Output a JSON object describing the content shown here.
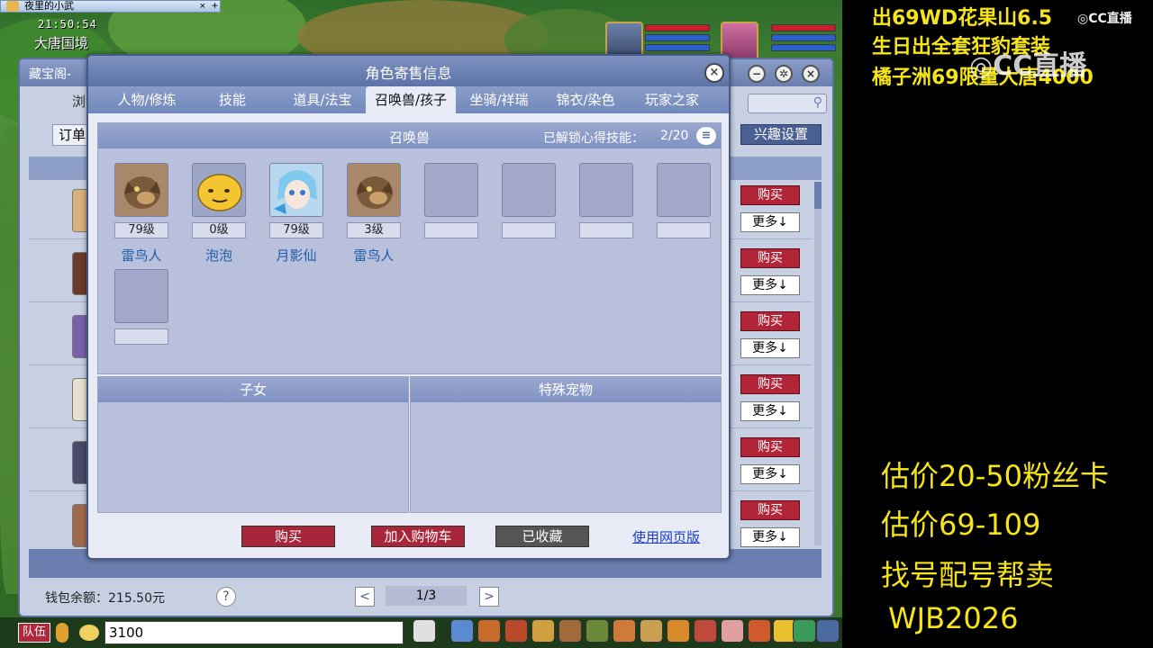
{
  "window": {
    "title": "夜里的小武",
    "close_glyph": "×",
    "plus_glyph": "+"
  },
  "hud": {
    "clock": "21:50:54",
    "location": "大唐国境"
  },
  "background_window": {
    "title": "藏宝阁-",
    "tab_partial": "浏",
    "order_partial": "订单",
    "interest_button": "兴趣设置",
    "buy_label": "购买",
    "more_label": "更多↓",
    "wallet": "钱包余额：215.50元",
    "help": "?",
    "prev": "<",
    "next": ">",
    "page": "1/3",
    "search_icon": "⚲"
  },
  "dialog": {
    "title": "角色寄售信息",
    "close": "×",
    "tabs": [
      {
        "label": "人物/修炼"
      },
      {
        "label": "技能"
      },
      {
        "label": "道具/法宝"
      },
      {
        "label": "召唤兽/孩子"
      },
      {
        "label": "坐骑/祥瑞"
      },
      {
        "label": "锦衣/染色"
      },
      {
        "label": "玩家之家"
      }
    ],
    "active_tab": "召唤兽/孩子",
    "pets_section": {
      "title": "召唤兽",
      "skill_label": "已解锁心得技能：",
      "skill_value": "2/20",
      "list_icon": "≡",
      "pets": [
        {
          "level": "79级",
          "name": "雷鸟人"
        },
        {
          "level": "0级",
          "name": "泡泡"
        },
        {
          "level": "79级",
          "name": "月影仙"
        },
        {
          "level": "3级",
          "name": "雷鸟人"
        }
      ]
    },
    "kids_section": {
      "title": "子女"
    },
    "special_section": {
      "title": "特殊宠物"
    },
    "buttons": {
      "buy": "购买",
      "add_cart": "加入购物车",
      "favorited": "已收藏",
      "web_version": "使用网页版"
    }
  },
  "bottom_bar": {
    "team": "队伍",
    "chat_value": "3100"
  },
  "overlay": {
    "top_lines": [
      "出69WD花果山6.5",
      "生日出全套狂豹套装",
      "橘子洲69限量大唐4000"
    ],
    "cc_logo": "CC直播",
    "bottom_lines": [
      "估价20-50粉丝卡",
      "估价69-109",
      "找号配号帮卖",
      "WJB2026"
    ]
  },
  "colors": {
    "overlay_yellow": "#f5e418",
    "buy_red": "#a8263a",
    "header_blue": "#5d73a8",
    "link_blue": "#1a3fcc",
    "pet_name_blue": "#1d5fa8"
  }
}
